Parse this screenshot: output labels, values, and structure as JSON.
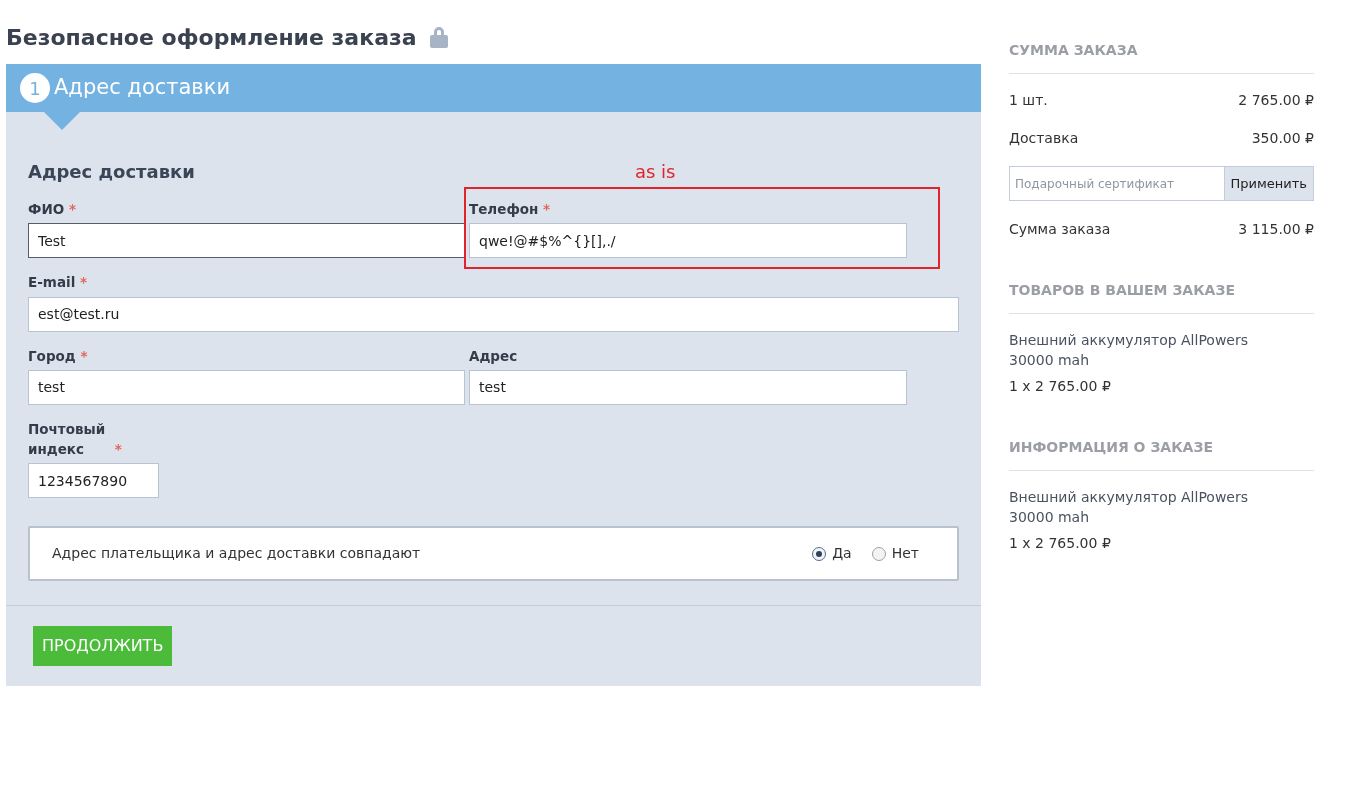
{
  "page_title": "Безопасное оформление заказа",
  "step": {
    "number": "1",
    "title": "Адрес доставки"
  },
  "form": {
    "heading": "Адрес доставки",
    "annotation": {
      "text": "as is"
    },
    "rows": [
      [
        {
          "kind": "name",
          "label": "ФИО",
          "required_mark": "*",
          "value": "Test",
          "focused": true
        },
        {
          "kind": "phone",
          "label": "Телефон",
          "required_mark": "*",
          "value": "qwe!@#$%^{}[],./",
          "focused": false,
          "annotated": true
        }
      ],
      [
        {
          "kind": "email",
          "label": "E-mail",
          "required_mark": "*",
          "value": "est@test.ru",
          "focused": false
        }
      ],
      [
        {
          "kind": "city",
          "label": "Город",
          "required_mark": "*",
          "value": "test",
          "focused": false
        },
        {
          "kind": "address",
          "label": "Адрес",
          "value": "test",
          "focused": false
        }
      ],
      [
        {
          "kind": "postal",
          "label": "Почтовый индекс",
          "required_mark": "*",
          "value": "1234567890",
          "focused": false
        }
      ]
    ],
    "match": {
      "text": "Адрес плательщика и адрес доставки совпадают",
      "options": [
        {
          "label": "Да",
          "selected": true
        },
        {
          "label": "Нет",
          "selected": false
        }
      ]
    },
    "continue_button": "ПРОДОЛЖИТЬ"
  },
  "summary": {
    "heading": "СУММА ЗАКАЗА",
    "lines": [
      {
        "label": "1 шт.",
        "value": "2 765.00 ₽"
      },
      {
        "label": "Доставка",
        "value": "350.00 ₽"
      }
    ],
    "coupon": {
      "placeholder": "Подарочный сертификат",
      "button": "Применить"
    },
    "total": {
      "label": "Сумма заказа",
      "value": "3 115.00 ₽"
    }
  },
  "items_section": {
    "heading": "ТОВАРОВ В ВАШЕМ ЗАКАЗЕ",
    "items": [
      {
        "name": "Внешний аккумулятор AllPowers 30000 mah",
        "price": "1 x 2 765.00 ₽"
      }
    ]
  },
  "info_section": {
    "heading": "ИНФОРМАЦИЯ О ЗАКАЗЕ",
    "items": [
      {
        "name": "Внешний аккумулятор AllPowers 30000 mah",
        "price": "1 x 2 765.00 ₽"
      }
    ]
  }
}
